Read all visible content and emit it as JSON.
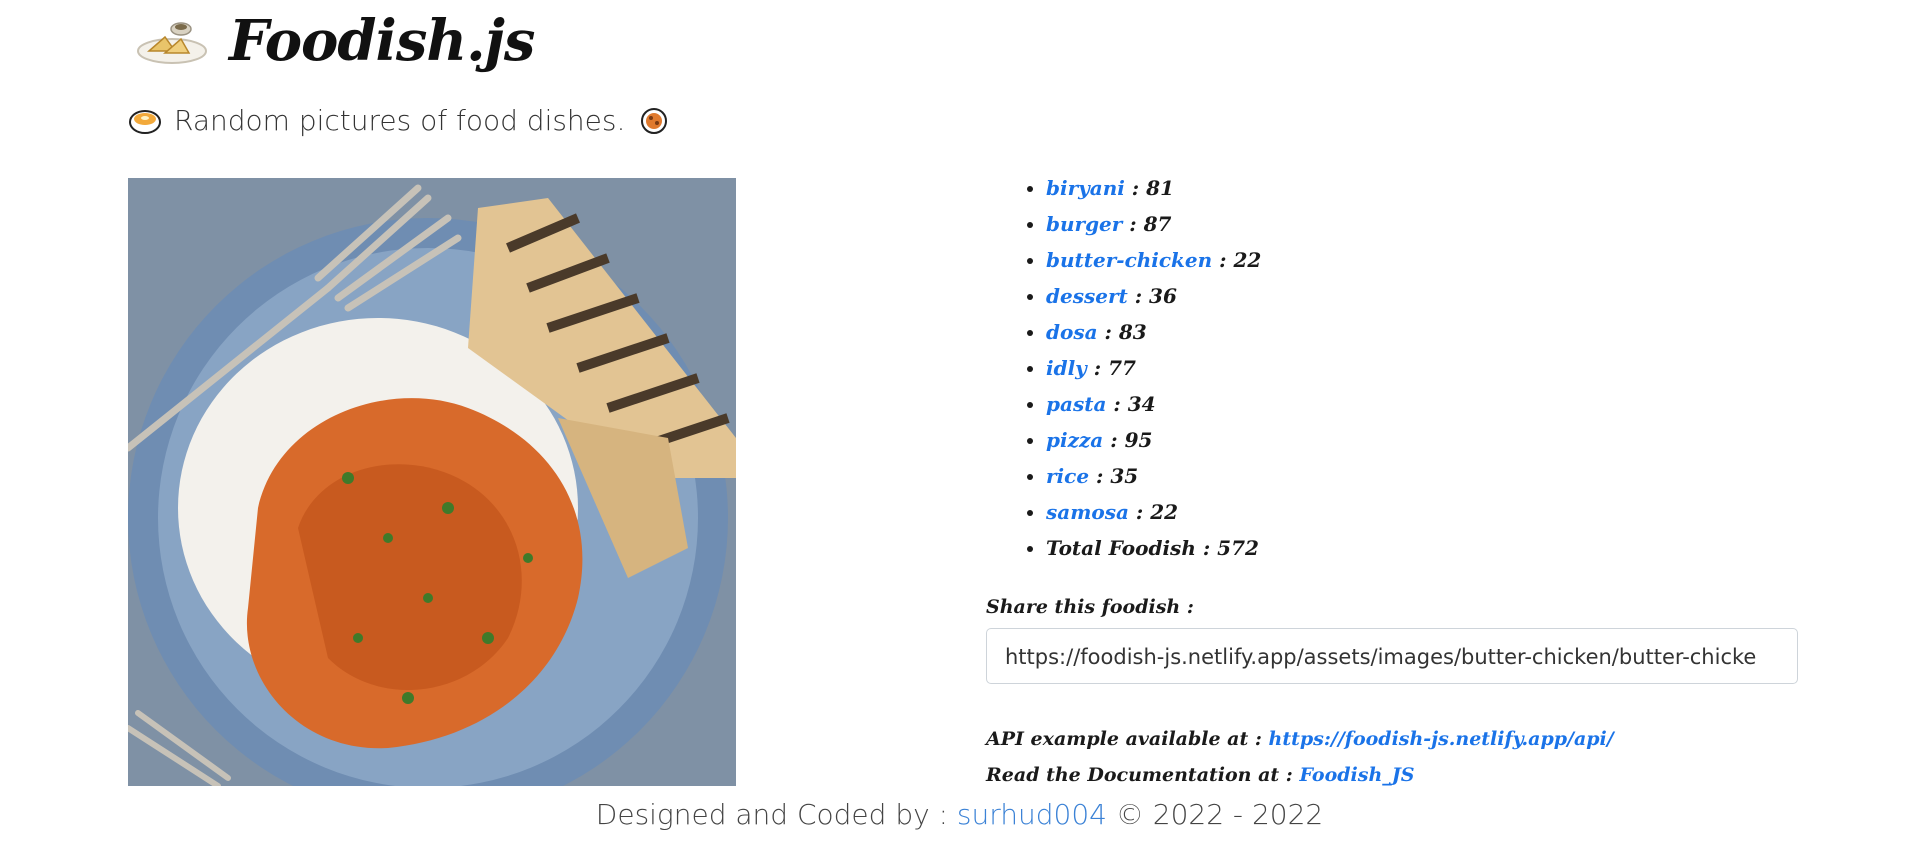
{
  "header": {
    "brand": "Foodish.js",
    "logo_icon": "plate-dumplings-icon"
  },
  "subtitle": {
    "text": "Random pictures of food dishes.",
    "left_icon": "curry-bowl-icon",
    "right_icon": "cookie-icon"
  },
  "image": {
    "icon": "butter-chicken-photo"
  },
  "categories": [
    {
      "name": "biryani",
      "count": "81"
    },
    {
      "name": "burger",
      "count": "87"
    },
    {
      "name": "butter-chicken",
      "count": "22"
    },
    {
      "name": "dessert",
      "count": "36"
    },
    {
      "name": "dosa",
      "count": "83"
    },
    {
      "name": "idly",
      "count": "77"
    },
    {
      "name": "pasta",
      "count": "34"
    },
    {
      "name": "pizza",
      "count": "95"
    },
    {
      "name": "rice",
      "count": "35"
    },
    {
      "name": "samosa",
      "count": "22"
    }
  ],
  "total": {
    "label": "Total Foodish",
    "count": "572"
  },
  "share": {
    "label": "Share this foodish :",
    "value": "https://foodish-js.netlify.app/assets/images/butter-chicken/butter-chicke"
  },
  "api": {
    "label": "API example available at :",
    "link": "https://foodish-js.netlify.app/api/"
  },
  "docs": {
    "label": "Read the Documentation at :",
    "link": "Foodish_JS"
  },
  "footer": {
    "prefix": "Designed and Coded by :",
    "author": "surhud004",
    "suffix": "© 2022 - 2022"
  },
  "colors": {
    "link": "#1a73e8",
    "text": "#1a1a1a"
  }
}
